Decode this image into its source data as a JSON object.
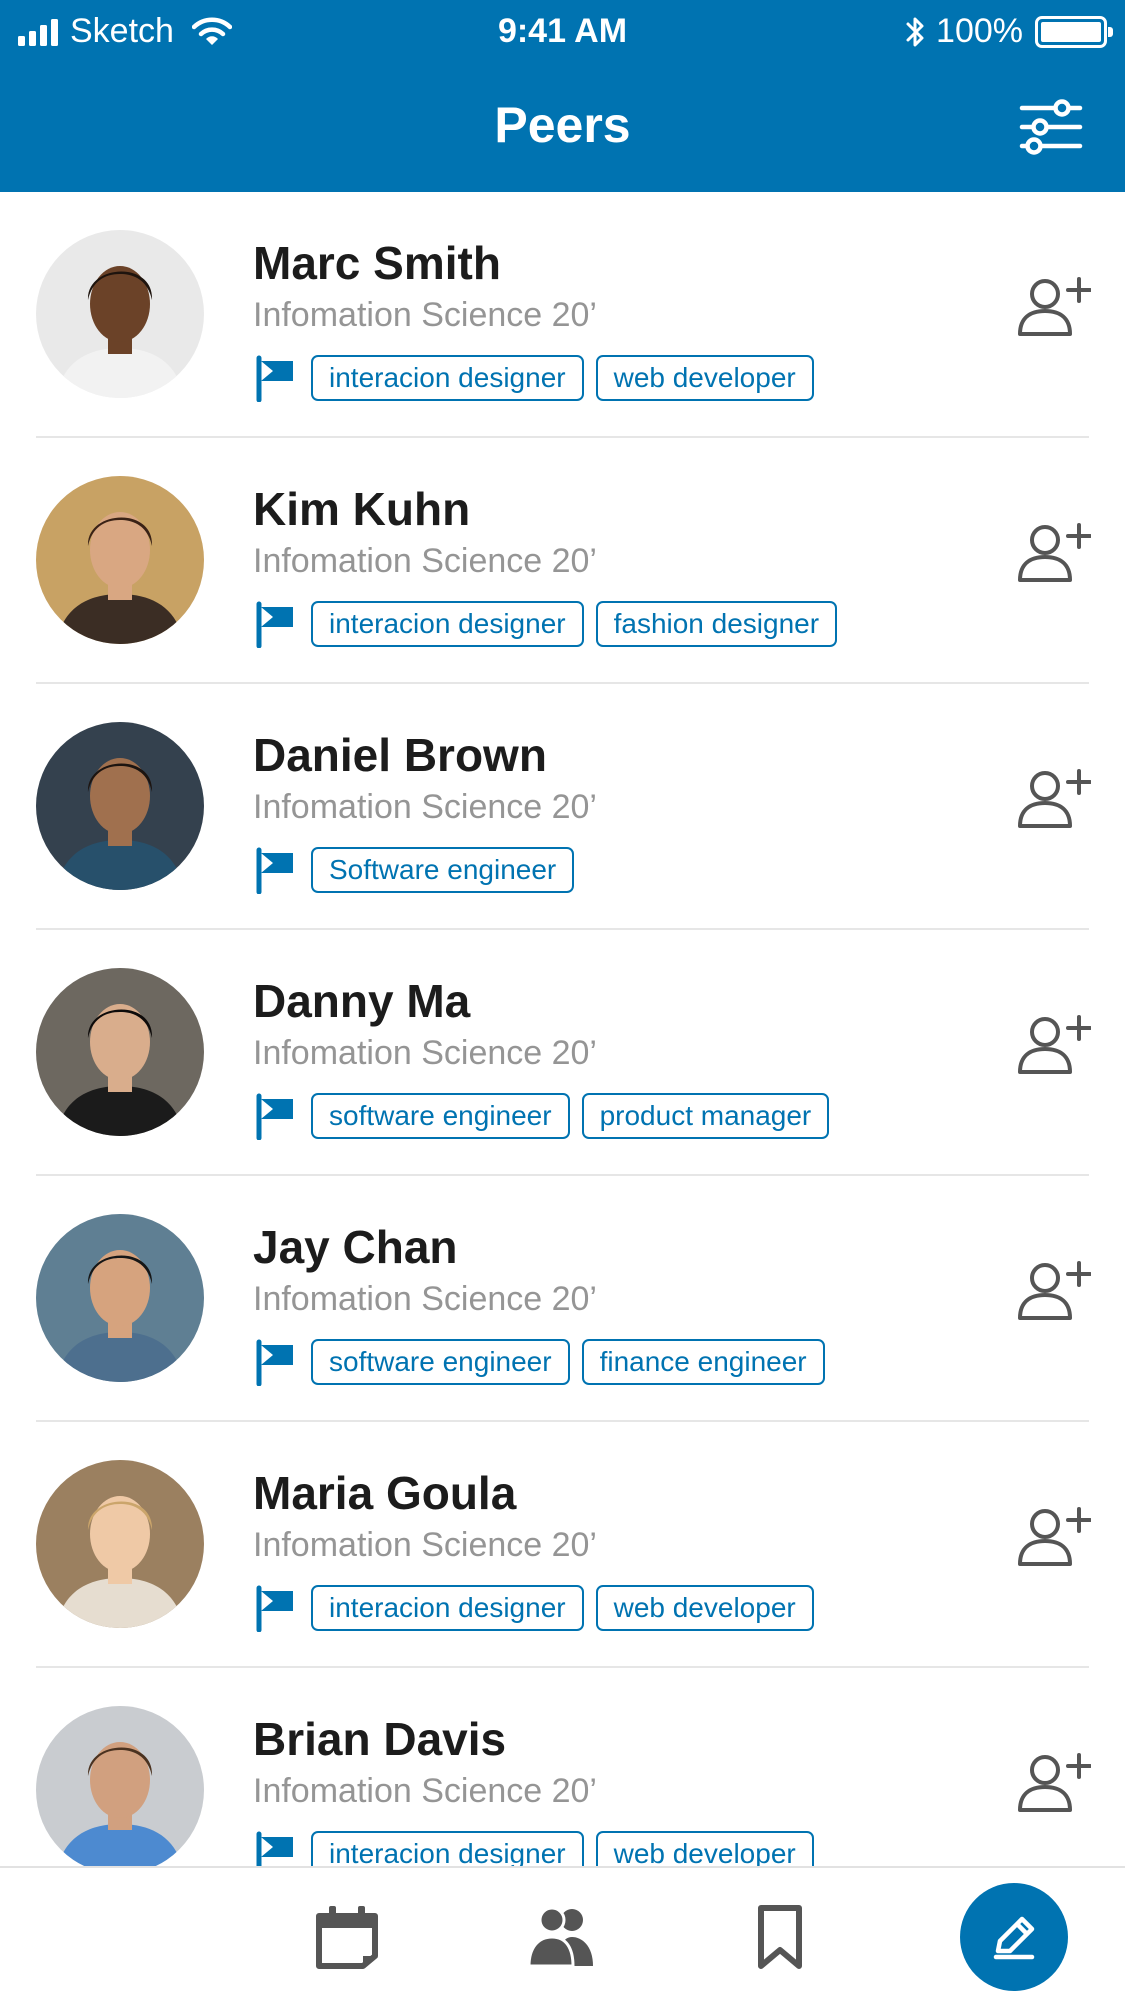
{
  "status_bar": {
    "carrier": "Sketch",
    "time": "9:41 AM",
    "battery": "100%"
  },
  "header": {
    "title": "Peers",
    "filter_icon": "sliders-icon"
  },
  "peers": [
    {
      "name": "Marc Smith",
      "program": "Infomation Science 20’",
      "tags": [
        "interacion designer",
        "web developer"
      ]
    },
    {
      "name": "Kim Kuhn",
      "program": "Infomation Science 20’",
      "tags": [
        "interacion designer",
        "fashion designer"
      ]
    },
    {
      "name": "Daniel Brown",
      "program": "Infomation Science 20’",
      "tags": [
        "Software engineer"
      ]
    },
    {
      "name": "Danny Ma",
      "program": "Infomation Science 20’",
      "tags": [
        "software engineer",
        "product manager"
      ]
    },
    {
      "name": "Jay Chan",
      "program": "Infomation Science 20’",
      "tags": [
        "software engineer",
        "finance engineer"
      ]
    },
    {
      "name": "Maria Goula",
      "program": "Infomation Science 20’",
      "tags": [
        "interacion designer",
        "web developer"
      ]
    },
    {
      "name": "Brian Davis",
      "program": "Infomation Science 20’",
      "tags": [
        "interacion designer",
        "web developer"
      ]
    }
  ],
  "tabbar": {
    "tabs": [
      "calendar-icon",
      "peers-icon",
      "bookmark-icon"
    ],
    "action": "pencil-icon"
  },
  "colors": {
    "brand": "#0073b1",
    "name_text": "#1c1c1c",
    "secondary_text": "#959595",
    "icon_gray": "#555555"
  }
}
